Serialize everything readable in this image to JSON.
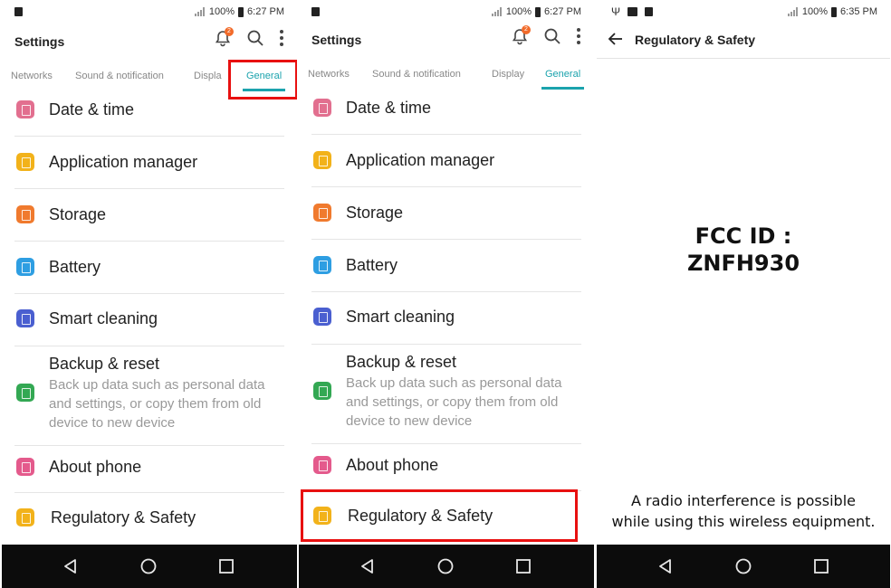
{
  "colors": {
    "accent": "#1ba3ad",
    "highlight": "#e81010",
    "icon_date_time": "#e26f8f",
    "icon_app_manager": "#f2b21a",
    "icon_storage": "#f07a2e",
    "icon_battery": "#2e9ee2",
    "icon_smart_cleaning": "#4a5fd0",
    "icon_backup": "#33a853",
    "icon_about": "#e45a8c",
    "icon_regulatory": "#f2b21a",
    "navbar": "#0c0c0c"
  },
  "status_bar_1": {
    "battery": "100%",
    "time": "6:27 PM"
  },
  "status_bar_3": {
    "battery": "100%",
    "time": "6:35 PM"
  },
  "settings": {
    "title": "Settings",
    "notification_badge": "2",
    "tabs": [
      "Networks",
      "Sound & notification",
      "Display",
      "General"
    ],
    "tabs_clipped_label": "Displa",
    "items": [
      {
        "label": "Date & time",
        "icon": "calendar-icon"
      },
      {
        "label": "Application manager",
        "icon": "apps-icon"
      },
      {
        "label": "Storage",
        "icon": "storage-icon"
      },
      {
        "label": "Battery",
        "icon": "battery-icon"
      },
      {
        "label": "Smart cleaning",
        "icon": "smart-cleaning-icon"
      },
      {
        "label": "Backup & reset",
        "icon": "backup-icon",
        "sub": "Back up data such as personal data and settings, or copy them from old device to new device"
      },
      {
        "label": "About phone",
        "icon": "phone-info-icon"
      },
      {
        "label": "Regulatory & Safety",
        "icon": "regulatory-icon"
      }
    ]
  },
  "regulatory": {
    "title": "Regulatory & Safety",
    "fcc_line1": "FCC ID :",
    "fcc_line2": "ZNFH930",
    "notice_line1": "A radio interference is possible",
    "notice_line2": "while using this wireless equipment."
  }
}
